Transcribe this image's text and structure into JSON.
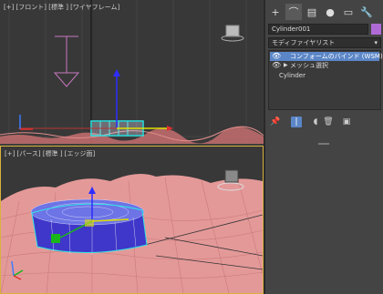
{
  "viewports": {
    "top": {
      "label": "[+] [フロント] [標準 ] [ワイヤフレーム]",
      "filter_icon": "funnel-icon"
    },
    "perspective": {
      "label": "[+] [パース] [標準 ] [エッジ面]",
      "filter_icon": "funnel-icon"
    }
  },
  "command_panel": {
    "tabs": [
      {
        "icon": "plus-icon",
        "glyph": "+"
      },
      {
        "icon": "modify-curve-icon",
        "glyph": "⌒"
      },
      {
        "icon": "hierarchy-icon",
        "glyph": "▤"
      },
      {
        "icon": "motion-icon",
        "glyph": "●"
      },
      {
        "icon": "display-icon",
        "glyph": "▭"
      },
      {
        "icon": "utilities-wrench-icon",
        "glyph": "🔧"
      }
    ],
    "object_name": "Cylinder001",
    "object_color": "#b06ad6",
    "modifier_list": "モディファイヤリスト",
    "stack": [
      {
        "label": "コンフォームのバインド (WSM)",
        "selected": true,
        "eye": true
      },
      {
        "label": "メッシュ選択",
        "selected": false,
        "eye": true,
        "expand": true
      },
      {
        "label": "Cylinder",
        "selected": false,
        "eye": false
      }
    ],
    "tools": [
      {
        "icon": "pin-stack-icon",
        "glyph": "📌"
      },
      {
        "icon": "show-end-result-icon",
        "glyph": "|"
      },
      {
        "icon": "make-unique-icon",
        "glyph": "◖"
      },
      {
        "icon": "remove-modifier-icon",
        "glyph": "🗑"
      },
      {
        "icon": "configure-sets-icon",
        "glyph": "▣"
      }
    ]
  },
  "colors": {
    "accent": "#5b86c7",
    "terrain": "#e59a9a",
    "selection": "#2ee6e6",
    "active_viewport": "#d9b23c"
  }
}
